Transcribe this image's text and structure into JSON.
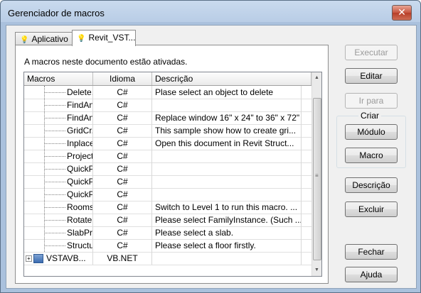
{
  "window": {
    "title": "Gerenciador de macros",
    "close_label": "✕"
  },
  "tabs": [
    {
      "label": "Aplicativo",
      "active": false
    },
    {
      "label": "Revit_VST...",
      "active": true
    }
  ],
  "status_text": "A macros neste documento estão ativadas.",
  "grid": {
    "columns": [
      "Macros",
      "Idioma",
      "Descrição"
    ],
    "rows": [
      {
        "name": "Delete...",
        "lang": "C#",
        "desc": "Plase select an object to delete"
      },
      {
        "name": "FindAn...",
        "lang": "C#",
        "desc": ""
      },
      {
        "name": "FindAn...",
        "lang": "C#",
        "desc": "Replace window 16\" x 24\" to 36\" x 72\""
      },
      {
        "name": "GridCr...",
        "lang": "C#",
        "desc": "This sample show how to create gri..."
      },
      {
        "name": "Inplace...",
        "lang": "C#",
        "desc": "Open this document in Revit Struct..."
      },
      {
        "name": "Project...",
        "lang": "C#",
        "desc": ""
      },
      {
        "name": "QuickP...",
        "lang": "C#",
        "desc": ""
      },
      {
        "name": "QuickP...",
        "lang": "C#",
        "desc": ""
      },
      {
        "name": "QuickP...",
        "lang": "C#",
        "desc": ""
      },
      {
        "name": "Rooms",
        "lang": "C#",
        "desc": "Switch to Level 1 to run this macro. ..."
      },
      {
        "name": "Rotate...",
        "lang": "C#",
        "desc": "Please select FamilyInstance. (Such ..."
      },
      {
        "name": "SlabPr...",
        "lang": "C#",
        "desc": "Please select a slab."
      },
      {
        "name": "Structure",
        "lang": "C#",
        "desc": "Please select a floor firstly."
      }
    ],
    "project_row": {
      "name": "VSTAVB...",
      "lang": "VB.NET",
      "desc": ""
    }
  },
  "buttons": {
    "run": "Executar",
    "edit": "Editar",
    "goto": "Ir para",
    "create_group": "Criar",
    "module": "Módulo",
    "macro": "Macro",
    "description": "Descrição",
    "delete": "Excluir",
    "close": "Fechar",
    "help": "Ajuda"
  }
}
